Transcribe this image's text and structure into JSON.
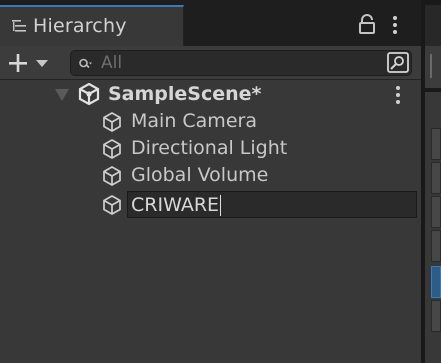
{
  "tab": {
    "title": "Hierarchy",
    "icon": "hierarchy-list-icon"
  },
  "tab_actions": {
    "lock_icon": "lock-icon",
    "menu_icon": "kebab-menu-icon"
  },
  "toolbar": {
    "add_icon": "plus-icon",
    "dropdown_icon": "chevron-down-icon"
  },
  "search": {
    "placeholder": "All",
    "value": "",
    "icon": "search-icon",
    "mode_icon": "search-mode-icon"
  },
  "scene": {
    "name": "SampleScene*",
    "icon": "unity-scene-icon",
    "expanded": true
  },
  "objects": [
    {
      "name": "Main Camera",
      "icon": "gameobject-cube-icon"
    },
    {
      "name": "Directional Light",
      "icon": "gameobject-cube-icon"
    },
    {
      "name": "Global Volume",
      "icon": "gameobject-cube-icon"
    }
  ],
  "renaming": {
    "value": "CRIWARE",
    "icon": "gameobject-cube-icon"
  },
  "colors": {
    "accent": "#3a79bb",
    "panel_bg": "#383838",
    "toolbar_bg": "#3c3c3c",
    "field_bg": "#2a2a2a",
    "text": "#c8c8c8"
  }
}
